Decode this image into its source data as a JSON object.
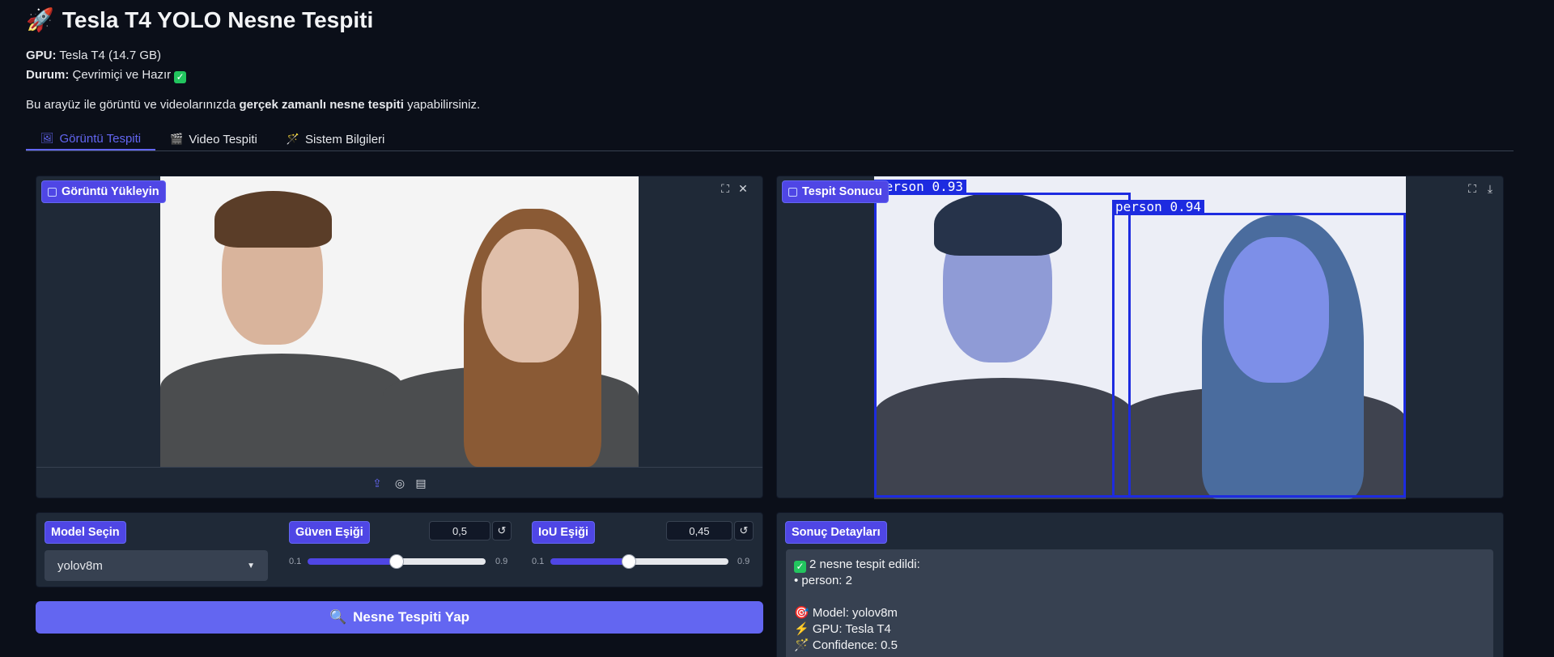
{
  "header": {
    "title": "Tesla T4 YOLO Nesne Tespiti",
    "gpu_label": "GPU:",
    "gpu_value": "Tesla T4 (14.7 GB)",
    "status_label": "Durum:",
    "status_value": "Çevrimiçi ve Hazır",
    "desc_pre": "Bu arayüz ile görüntü ve videolarınızda ",
    "desc_bold": "gerçek zamanlı nesne tespiti",
    "desc_post": " yapabilirsiniz."
  },
  "tabs": [
    {
      "label": "Görüntü Tespiti",
      "active": true
    },
    {
      "label": "Video Tespiti",
      "active": false
    },
    {
      "label": "Sistem Bilgileri",
      "active": false
    }
  ],
  "upload": {
    "label": "Görüntü Yükleyin"
  },
  "result_image": {
    "label": "Tespit Sonucu",
    "detections": [
      {
        "class": "person",
        "score": "0.93"
      },
      {
        "class": "person",
        "score": "0.94"
      }
    ],
    "bbox_color": "#1d2be0"
  },
  "model": {
    "label": "Model Seçin",
    "selected": "yolov8m"
  },
  "confidence": {
    "label": "Güven Eşiği",
    "value": "0,5",
    "min": "0.1",
    "max": "0.9",
    "fraction": 0.5
  },
  "iou": {
    "label": "IoU Eşiği",
    "value": "0,45",
    "min": "0.1",
    "max": "0.9",
    "fraction": 0.44
  },
  "run_button": {
    "label": "Nesne Tespiti Yap"
  },
  "details": {
    "label": "Sonuç Detayları",
    "lines": [
      "2 nesne tespit edildi:",
      "• person: 2",
      "",
      "Model: yolov8m",
      "GPU: Tesla T4",
      "Confidence: 0.5"
    ]
  },
  "colors": {
    "accent": "#6366f1",
    "background": "#0b0f19",
    "panel": "#1f2937"
  }
}
